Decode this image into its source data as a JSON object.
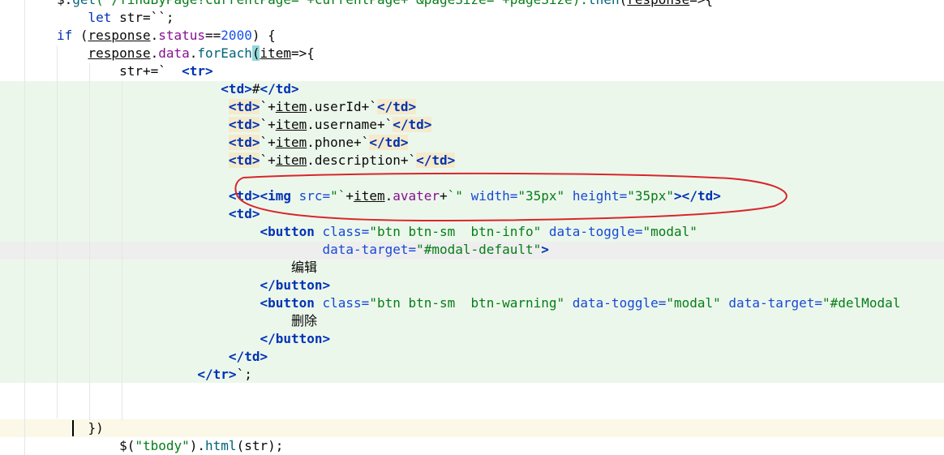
{
  "colors": {
    "background": "#ffffff",
    "template_band": "#ecf7ec",
    "current_line": "#fbf8e8",
    "selected_line": "#eeeeee",
    "keyword": "#0033b3",
    "string": "#067d17",
    "property": "#871094",
    "function": "#00627a",
    "annotation_ellipse": "#d9262b",
    "tag_highlight": "#f5eacb"
  },
  "code": {
    "lines": [
      [
        {
          "t": "$.",
          "c": ""
        },
        {
          "t": "get",
          "c": "fn"
        },
        {
          "t": "(`/findByPage?currentPage=`+currentPage+`&pageSize=`+pageSize).",
          "c": "str"
        },
        {
          "t": "then",
          "c": "fn"
        },
        {
          "t": "(",
          "c": ""
        },
        {
          "t": "response",
          "c": "ul"
        },
        {
          "t": "=>{",
          "c": ""
        }
      ],
      [
        {
          "t": "    ",
          "c": ""
        },
        {
          "t": "let",
          "c": "kw"
        },
        {
          "t": " str=``;",
          "c": ""
        }
      ],
      [
        {
          "t": "if",
          "c": "kw"
        },
        {
          "t": " (",
          "c": ""
        },
        {
          "t": "response",
          "c": "ul"
        },
        {
          "t": ".",
          "c": ""
        },
        {
          "t": "status",
          "c": "prop"
        },
        {
          "t": "==",
          "c": ""
        },
        {
          "t": "2000",
          "c": "num"
        },
        {
          "t": ") {",
          "c": ""
        }
      ],
      [
        {
          "t": "    ",
          "c": ""
        },
        {
          "t": "response",
          "c": "ul"
        },
        {
          "t": ".",
          "c": ""
        },
        {
          "t": "data",
          "c": "prop"
        },
        {
          "t": ".",
          "c": ""
        },
        {
          "t": "forEach",
          "c": "fn"
        },
        {
          "t": "(",
          "c": "paren"
        },
        {
          "t": "item",
          "c": "ul"
        },
        {
          "t": "=>{",
          "c": ""
        }
      ],
      [
        {
          "t": "        str+=`  ",
          "c": ""
        },
        {
          "t": "<tr>",
          "c": "tag"
        }
      ],
      [
        {
          "t": "                     ",
          "c": ""
        },
        {
          "t": "<td>",
          "c": "tag"
        },
        {
          "t": "#",
          "c": ""
        },
        {
          "t": "</td>",
          "c": "tag"
        }
      ],
      [
        {
          "t": "                      ",
          "c": ""
        },
        {
          "t": "<td>",
          "c": "tag hl"
        },
        {
          "t": "`+",
          "c": ""
        },
        {
          "t": "item",
          "c": "ul"
        },
        {
          "t": ".userId+`",
          "c": ""
        },
        {
          "t": "</td>",
          "c": "tag hl"
        }
      ],
      [
        {
          "t": "                      ",
          "c": ""
        },
        {
          "t": "<td>",
          "c": "tag hl"
        },
        {
          "t": "`+",
          "c": ""
        },
        {
          "t": "item",
          "c": "ul"
        },
        {
          "t": ".username+`",
          "c": ""
        },
        {
          "t": "</td>",
          "c": "tag hl"
        }
      ],
      [
        {
          "t": "                      ",
          "c": ""
        },
        {
          "t": "<td>",
          "c": "tag hl"
        },
        {
          "t": "`+",
          "c": ""
        },
        {
          "t": "item",
          "c": "ul"
        },
        {
          "t": ".phone+`",
          "c": ""
        },
        {
          "t": "</td>",
          "c": "tag hl"
        }
      ],
      [
        {
          "t": "                      ",
          "c": ""
        },
        {
          "t": "<td>",
          "c": "tag hl"
        },
        {
          "t": "`+",
          "c": ""
        },
        {
          "t": "item",
          "c": "ul"
        },
        {
          "t": ".description+`",
          "c": ""
        },
        {
          "t": "</td>",
          "c": "tag hl"
        }
      ],
      [
        {
          "t": "",
          "c": ""
        }
      ],
      [
        {
          "t": "                      ",
          "c": ""
        },
        {
          "t": "<td><img ",
          "c": "tag"
        },
        {
          "t": "src=",
          "c": "attr"
        },
        {
          "t": "\"`",
          "c": "str"
        },
        {
          "t": "+",
          "c": ""
        },
        {
          "t": "item",
          "c": "ul"
        },
        {
          "t": ".",
          "c": ""
        },
        {
          "t": "avater",
          "c": "prop"
        },
        {
          "t": "+",
          "c": ""
        },
        {
          "t": "`\" ",
          "c": "str"
        },
        {
          "t": "width=",
          "c": "attr"
        },
        {
          "t": "\"35px\" ",
          "c": "str"
        },
        {
          "t": "height=",
          "c": "attr"
        },
        {
          "t": "\"35px\"",
          "c": "str"
        },
        {
          "t": "></td>",
          "c": "tag"
        }
      ],
      [
        {
          "t": "                      ",
          "c": ""
        },
        {
          "t": "<td>",
          "c": "tag"
        }
      ],
      [
        {
          "t": "                          ",
          "c": ""
        },
        {
          "t": "<button ",
          "c": "tag"
        },
        {
          "t": "class=",
          "c": "attr"
        },
        {
          "t": "\"btn btn-sm  btn-info\" ",
          "c": "str"
        },
        {
          "t": "data-toggle=",
          "c": "attr"
        },
        {
          "t": "\"modal\"",
          "c": "str"
        }
      ],
      [
        {
          "t": "                                  ",
          "c": ""
        },
        {
          "t": "data-target=",
          "c": "attr"
        },
        {
          "t": "\"#modal-default\"",
          "c": "str"
        },
        {
          "t": ">",
          "c": "tag"
        }
      ],
      [
        {
          "t": "                              ",
          "c": ""
        },
        {
          "t": "编辑",
          "c": "cjk"
        }
      ],
      [
        {
          "t": "                          ",
          "c": ""
        },
        {
          "t": "</button>",
          "c": "tag"
        }
      ],
      [
        {
          "t": "                          ",
          "c": ""
        },
        {
          "t": "<button ",
          "c": "tag"
        },
        {
          "t": "class=",
          "c": "attr"
        },
        {
          "t": "\"btn btn-sm  btn-warning\" ",
          "c": "str"
        },
        {
          "t": "data-toggle=",
          "c": "attr"
        },
        {
          "t": "\"modal\" ",
          "c": "str"
        },
        {
          "t": "data-target=",
          "c": "attr"
        },
        {
          "t": "\"#delModal",
          "c": "str"
        }
      ],
      [
        {
          "t": "                              ",
          "c": ""
        },
        {
          "t": "删除",
          "c": "cjk"
        }
      ],
      [
        {
          "t": "                          ",
          "c": ""
        },
        {
          "t": "</button>",
          "c": "tag"
        }
      ],
      [
        {
          "t": "                      ",
          "c": ""
        },
        {
          "t": "</td>",
          "c": "tag"
        }
      ],
      [
        {
          "t": "                  ",
          "c": ""
        },
        {
          "t": "</tr>",
          "c": "tag"
        },
        {
          "t": "`;",
          "c": ""
        }
      ],
      [
        {
          "t": "",
          "c": ""
        }
      ],
      [
        {
          "t": "",
          "c": ""
        }
      ],
      [
        {
          "t": "    })",
          "c": ""
        }
      ],
      [
        {
          "t": "        $(",
          "c": ""
        },
        {
          "t": "\"tbody\"",
          "c": "str"
        },
        {
          "t": ").",
          "c": ""
        },
        {
          "t": "html",
          "c": "fn"
        },
        {
          "t": "(str);",
          "c": ""
        }
      ]
    ]
  }
}
